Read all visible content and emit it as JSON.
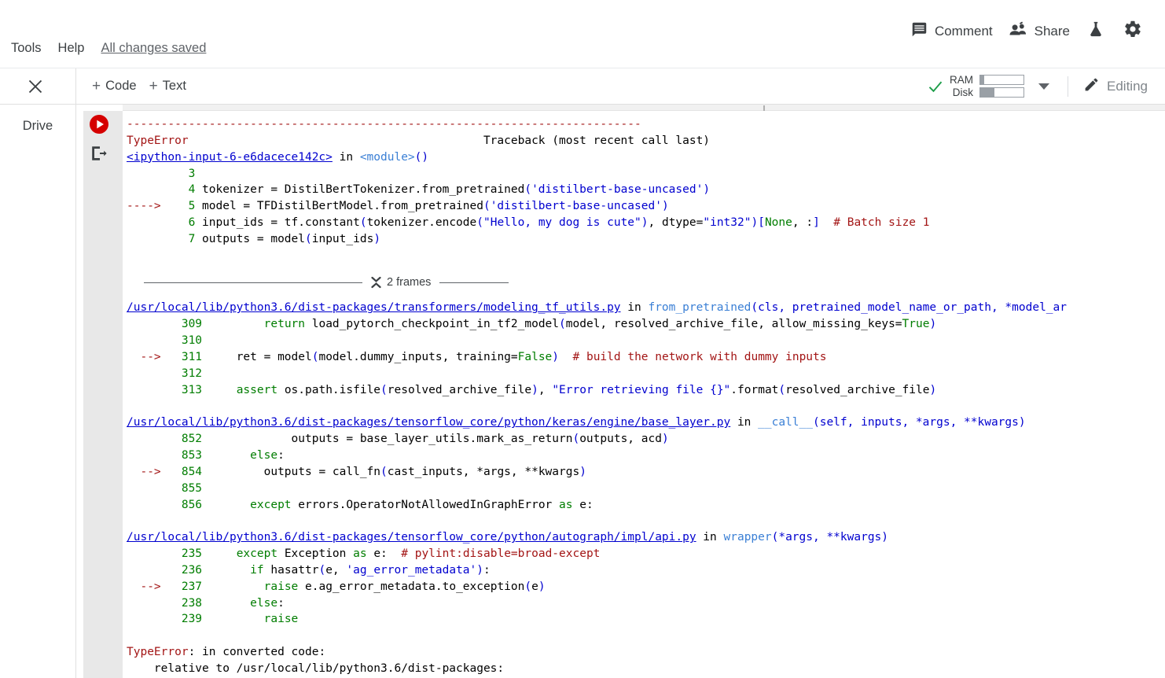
{
  "menubar": {
    "items": [
      {
        "label": "Tools",
        "name": "menu-tools"
      },
      {
        "label": "Help",
        "name": "menu-help"
      }
    ],
    "save_status": "All changes saved",
    "comment_label": "Comment",
    "share_label": "Share",
    "icons": {
      "comment": "comment-icon",
      "share": "people-icon",
      "flask": "flask-icon",
      "settings": "gear-icon"
    }
  },
  "toolbar": {
    "close_label": "close-icon",
    "add_code_label": "+ Code",
    "add_code_plus": "+",
    "add_code_text": "Code",
    "add_text_plus": "+",
    "add_text_text": "Text",
    "ram_label": "RAM",
    "disk_label": "Disk",
    "ram_fill_pct": 9,
    "disk_fill_pct": 33,
    "editing_label": "Editing"
  },
  "leftrail": {
    "drive_label": "Drive"
  },
  "cell": {
    "run_button": "run-cell-button",
    "output_icon": "output-toggle-icon",
    "frames_divider": {
      "label": "2 frames",
      "count": 2
    }
  },
  "traceback": {
    "separator": "---------------------------------------------------------------------------",
    "error_header_name": "TypeError",
    "error_header_right": "Traceback (most recent call last)",
    "frames": [
      {
        "file_link": "<ipython-input-6-e6dacece142c>",
        "in_word": "in",
        "func_sig": "<module>()",
        "lines": [
          {
            "marker": "",
            "num": "3",
            "code": ""
          },
          {
            "marker": "",
            "num": "4",
            "code": "tokenizer = DistilBertTokenizer.from_pretrained('distilbert-base-uncased')"
          },
          {
            "marker": "---->",
            "num": "5",
            "code": "model = TFDistilBertModel.from_pretrained('distilbert-base-uncased')"
          },
          {
            "marker": "",
            "num": "6",
            "code": "input_ids = tf.constant(tokenizer.encode(\"Hello, my dog is cute\"), dtype=\"int32\")[None, :]  # Batch size 1"
          },
          {
            "marker": "",
            "num": "7",
            "code": "outputs = model(input_ids)"
          }
        ]
      },
      {
        "file_link": "/usr/local/lib/python3.6/dist-packages/transformers/modeling_tf_utils.py",
        "in_word": "in",
        "func_sig": "from_pretrained(cls, pretrained_model_name_or_path, *model_ar",
        "lines": [
          {
            "marker": "",
            "num": "309",
            "code": "        return load_pytorch_checkpoint_in_tf2_model(model, resolved_archive_file, allow_missing_keys=True)"
          },
          {
            "marker": "",
            "num": "310",
            "code": ""
          },
          {
            "marker": "-->",
            "num": "311",
            "code": "    ret = model(model.dummy_inputs, training=False)  # build the network with dummy inputs"
          },
          {
            "marker": "",
            "num": "312",
            "code": ""
          },
          {
            "marker": "",
            "num": "313",
            "code": "    assert os.path.isfile(resolved_archive_file), \"Error retrieving file {}\".format(resolved_archive_file)"
          }
        ]
      },
      {
        "file_link": "/usr/local/lib/python3.6/dist-packages/tensorflow_core/python/keras/engine/base_layer.py",
        "in_word": "in",
        "func_sig": "__call__(self, inputs, *args, **kwargs)",
        "lines": [
          {
            "marker": "",
            "num": "852",
            "code": "            outputs = base_layer_utils.mark_as_return(outputs, acd)"
          },
          {
            "marker": "",
            "num": "853",
            "code": "      else:"
          },
          {
            "marker": "-->",
            "num": "854",
            "code": "        outputs = call_fn(cast_inputs, *args, **kwargs)"
          },
          {
            "marker": "",
            "num": "855",
            "code": ""
          },
          {
            "marker": "",
            "num": "856",
            "code": "      except errors.OperatorNotAllowedInGraphError as e:"
          }
        ]
      },
      {
        "file_link": "/usr/local/lib/python3.6/dist-packages/tensorflow_core/python/autograph/impl/api.py",
        "in_word": "in",
        "func_sig": "wrapper(*args, **kwargs)",
        "lines": [
          {
            "marker": "",
            "num": "235",
            "code": "    except Exception as e:  # pylint:disable=broad-except"
          },
          {
            "marker": "",
            "num": "236",
            "code": "      if hasattr(e, 'ag_error_metadata'):"
          },
          {
            "marker": "-->",
            "num": "237",
            "code": "        raise e.ag_error_metadata.to_exception(e)"
          },
          {
            "marker": "",
            "num": "238",
            "code": "      else:"
          },
          {
            "marker": "",
            "num": "239",
            "code": "        raise"
          }
        ]
      }
    ],
    "final_error_name": "TypeError",
    "final_error_msg": ": in converted code:",
    "final_error_line2": "    relative to /usr/local/lib/python3.6/dist-packages:"
  },
  "colors": {
    "error_red": "#a31515",
    "keyword_green": "#007d00",
    "string_blue": "#0000cf",
    "func_blue": "#3a7fd5",
    "link_blue": "#0000cf",
    "gutter_gray": "#e8e8e8",
    "run_button_red": "#d50000",
    "check_green": "#1e9e4a"
  }
}
